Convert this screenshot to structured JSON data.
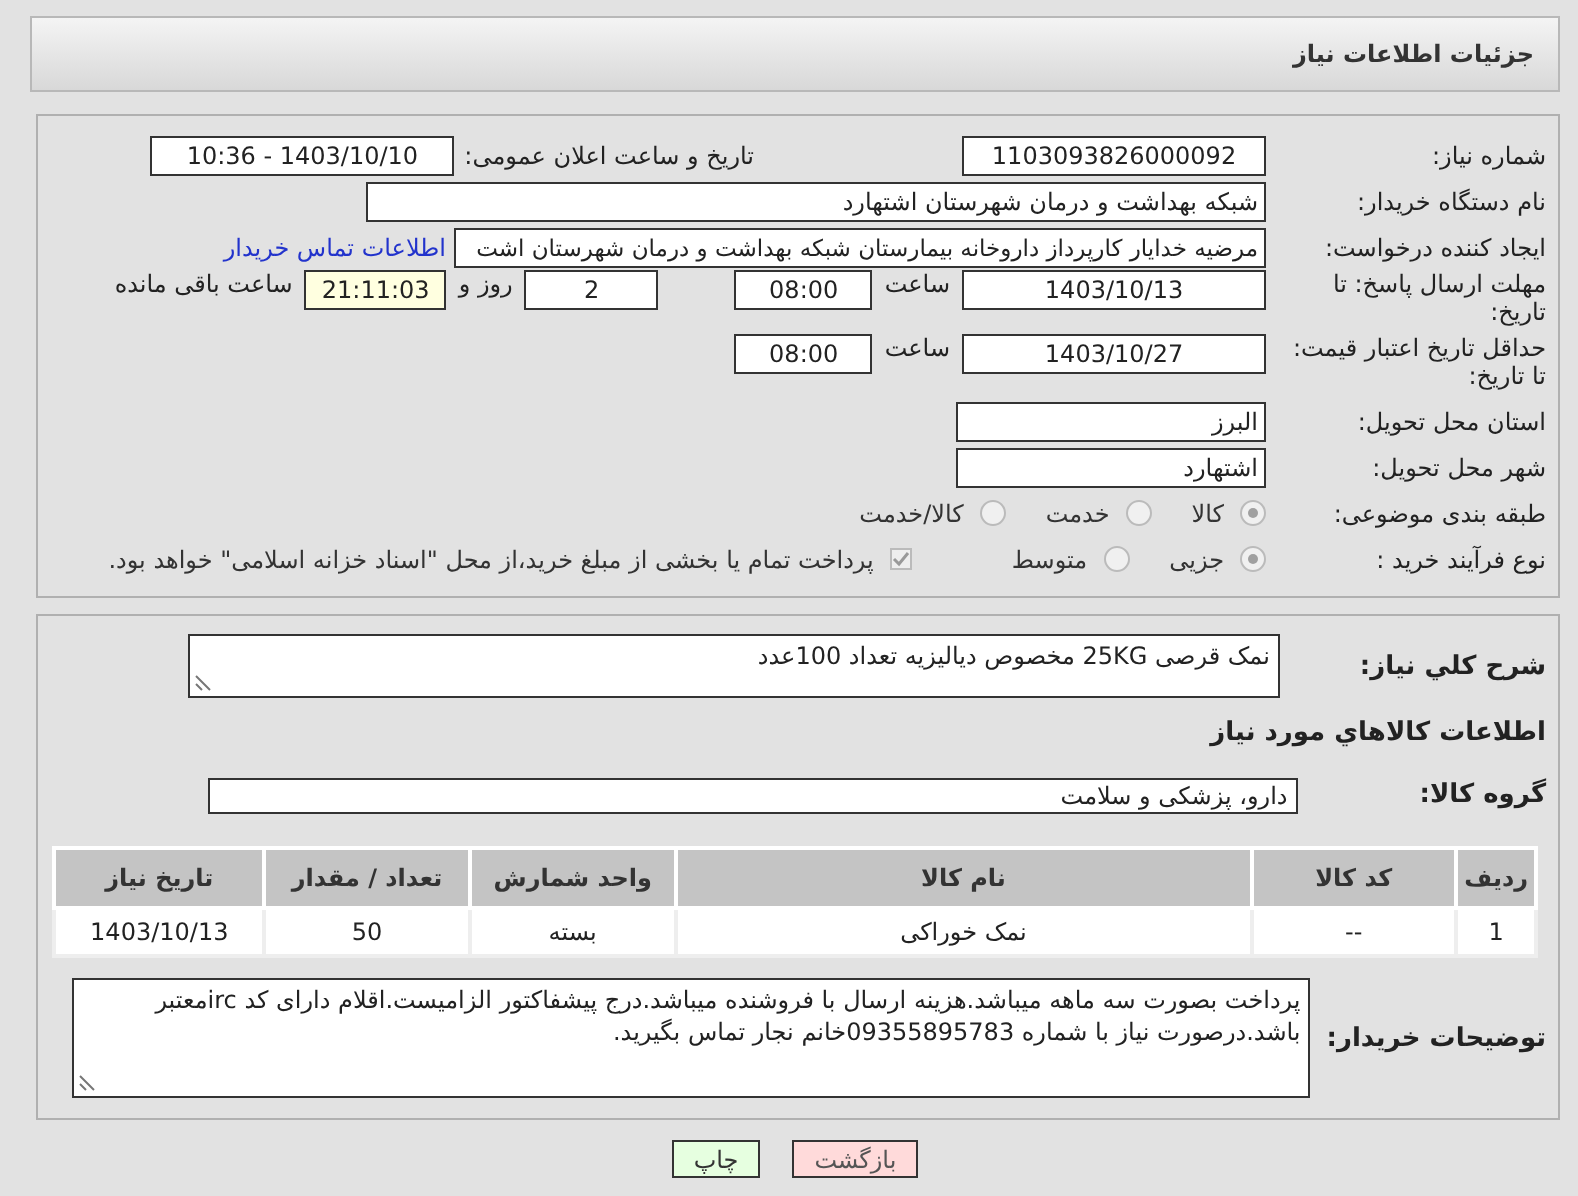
{
  "header": {
    "title": "جزئیات اطلاعات نیاز"
  },
  "details": {
    "need_number": {
      "label": "شماره نیاز:",
      "value": "1103093826000092"
    },
    "announce_datetime": {
      "label": "تاریخ و ساعت اعلان عمومی:",
      "value": "1403/10/10 - 10:36"
    },
    "buyer_org": {
      "label": "نام دستگاه خریدار:",
      "value": "شبکه بهداشت و درمان شهرستان اشتهارد"
    },
    "requester": {
      "label": "ایجاد کننده درخواست:",
      "value": "مرضیه خدایار کارپرداز داروخانه بیمارستان شبکه بهداشت و درمان شهرستان اشت",
      "link": "اطلاعات تماس خریدار"
    },
    "reply_deadline": {
      "label": "مهلت ارسال پاسخ: تا تاریخ:",
      "date": "1403/10/13",
      "time_label": "ساعت",
      "time": "08:00",
      "days": "2",
      "days_label": "روز و",
      "remaining": "21:11:03",
      "remaining_label": "ساعت باقی مانده"
    },
    "price_validity": {
      "label": "حداقل تاریخ اعتبار قیمت: تا تاریخ:",
      "date": "1403/10/27",
      "time_label": "ساعت",
      "time": "08:00"
    },
    "province": {
      "label": "استان محل تحویل:",
      "value": "البرز"
    },
    "city": {
      "label": "شهر محل تحویل:",
      "value": "اشتهارد"
    },
    "category": {
      "label": "طبقه بندی موضوعی:",
      "options": [
        {
          "label": "کالا",
          "selected": true
        },
        {
          "label": "خدمت",
          "selected": false
        },
        {
          "label": "کالا/خدمت",
          "selected": false
        }
      ]
    },
    "purchase_process": {
      "label": "نوع فرآیند خرید :",
      "options": [
        {
          "label": "جزیی",
          "selected": true
        },
        {
          "label": "متوسط",
          "selected": false
        }
      ],
      "payment_note": {
        "checked": true,
        "text": "پرداخت تمام یا بخشی از مبلغ خرید،از محل \"اسناد خزانه اسلامی\" خواهد بود."
      }
    }
  },
  "need_summary": {
    "label": "شرح کلي نياز:",
    "value": "نمک قرصی 25KG مخصوص دیالیزیه تعداد 100عدد"
  },
  "goods_heading": "اطلاعات کالاهاي مورد نياز",
  "goods_group": {
    "label": "گروه کالا:",
    "value": "دارو، پزشکی و سلامت"
  },
  "table": {
    "columns": [
      "ردیف",
      "کد کالا",
      "نام کالا",
      "واحد شمارش",
      "تعداد / مقدار",
      "تاریخ نیاز"
    ],
    "rows": [
      [
        "1",
        "--",
        "نمک خوراکی",
        "بسته",
        "50",
        "1403/10/13"
      ]
    ]
  },
  "buyer_notes": {
    "label": "توضیحات خریدار:",
    "value": "پرداخت بصورت سه ماهه میباشد.هزینه ارسال با فروشنده میباشد.درج پیشفاکتور الزامیست.اقلام دارای کد ircمعتبر باشد.درصورت نیاز با شماره 09355895783خانم نجار تماس بگیرید."
  },
  "buttons": [
    {
      "label": "بازگشت",
      "kind": "back"
    },
    {
      "label": "چاپ",
      "kind": "print"
    }
  ]
}
